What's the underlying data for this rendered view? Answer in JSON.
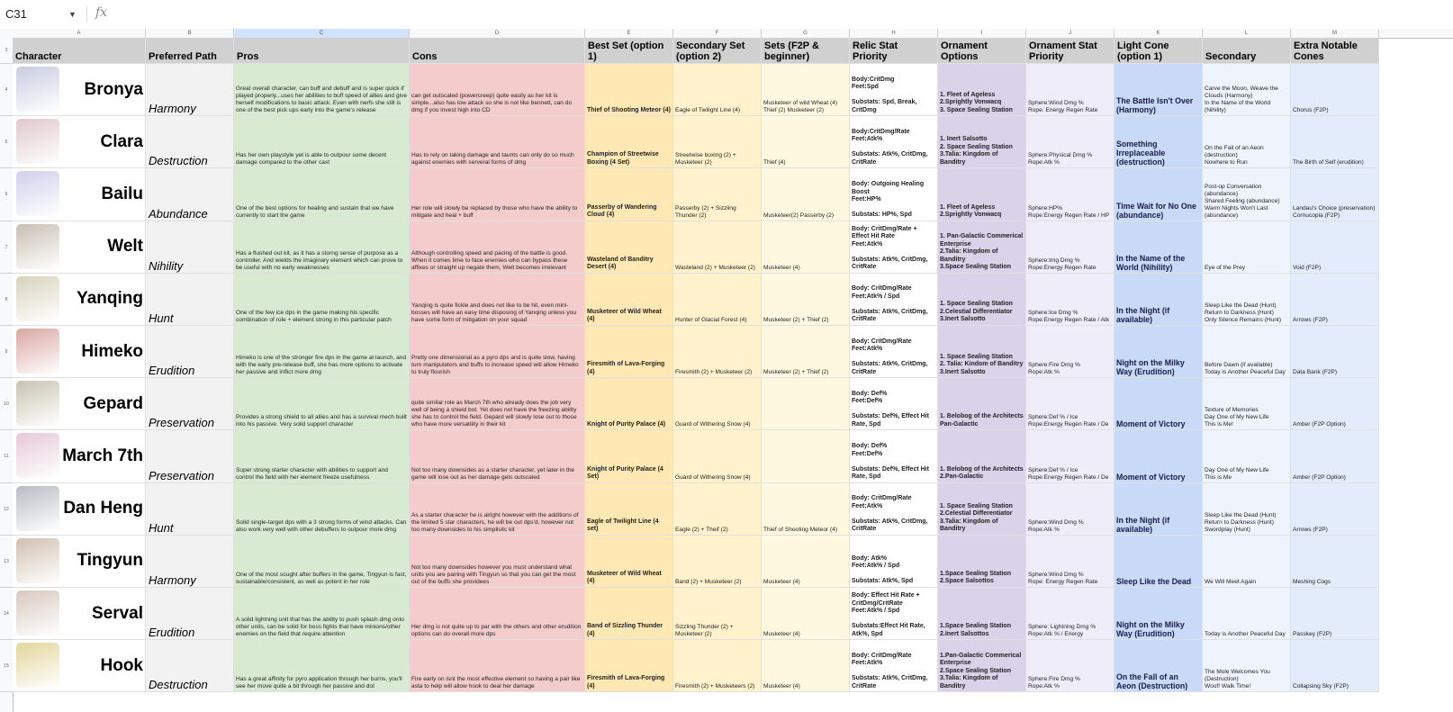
{
  "formula_bar": {
    "cell_ref": "C31",
    "fx_label": "fx",
    "formula": ""
  },
  "column_letters": [
    "A",
    "B",
    "C",
    "D",
    "E",
    "F",
    "G",
    "H",
    "I",
    "J",
    "K",
    "L",
    "M"
  ],
  "selected_column": "C",
  "row_numbers": [
    "3",
    "4",
    "5",
    "6",
    "7",
    "8",
    "9",
    "10",
    "11",
    "12",
    "13",
    "14",
    "15"
  ],
  "headers": [
    "Character",
    "Preferred Path",
    "Pros",
    "Cons",
    "Best Set (option 1)",
    "Secondary Set (option 2)",
    "Sets (F2P & beginner)",
    "Relic Stat Priority",
    "Ornament Options",
    "Ornament Stat Priority",
    "Light Cone (option 1)",
    "Secondary",
    "Extra Notable Cones"
  ],
  "characters": [
    {
      "name": "Bronya",
      "path": "Harmony",
      "portrait_color": "#c8cde0",
      "pros": "Great overall character, can buff and debuff and is super quick if played properly...uses her abilities to buff speed of allies and give herself modifications to basic attack. Even with nerfs she still is one of the best pick ups early into the game's release",
      "cons": "can get outscaled (powercreep) quite easily as her kit is simple...also has low attack so she is not like bennett, can do dmg if you invest high into CD",
      "best": "Thief of Shooting Meteor (4)",
      "secondary": "Eagle of Twilight Line (4)",
      "sets": "Musketeer of wild Wheat (4)\nThief (2) Musketeer (2)",
      "relic": "Body:CritDmg\nFeet:Spd\n\nSubstats: Spd, Break, CritDmg",
      "ornament": "1. Fleet of Ageless\n2.Sprightly Vonwacq\n3. Space Sealing Station",
      "ornament_stat": "Sphere:Wind Dmg %\nRope: Energy Regen Rate",
      "lc": "The Battle Isn't Over (Harmony)",
      "lc2": "Carve the Moon, Weave the Clouds (Harmony)\nIn the Name of the World (Nihility)",
      "extra": "Chorus (F2P)"
    },
    {
      "name": "Clara",
      "path": "Destruction",
      "portrait_color": "#e0c8cc",
      "pros": "Has her own playstyle yet is able to outpour some decent damage compared to the other cast",
      "cons": "Has to rely on taking damage and taunts can only do so much against enemies with serveral forms of dmg",
      "best": "Champion of Streetwise Boxing (4 Set)",
      "secondary": "Streetwise boxing (2) + Musketeer (2)",
      "sets": "Thief (4)",
      "relic": "Body:CritDmg/Rate\nFeet:Atk%\n\nSubstats: Atk%, CritDmg, CritRate",
      "ornament": "1. Inert Salsotto\n2. Space Sealing Station\n3.Talia: Kingdom of Banditry",
      "ornament_stat": "Sphere:Physical Dmg %\nRope:Atk %",
      "lc": "Something Irreplaceable (destruction)",
      "lc2": "On the Fall of an Aeon (destruction)\nNowhere to Run",
      "extra": "The Birth of Self (erudition)"
    },
    {
      "name": "Bailu",
      "path": "Abundance",
      "portrait_color": "#cfd0ea",
      "pros": "One of the best options for healing and sustain that we have currently to start the game",
      "cons": "Her role will slowly be replaced by those who have the ability to mitigate and heal + buff",
      "best": "Passerby of Wandering Cloud (4)",
      "secondary": "Passerby (2) + Sizzling Thunder (2)",
      "sets": "Musketeer(2) Passerby (2)",
      "relic": "Body: Outgoing Healing Boost\nFeet:HP%\n\nSubstats: HP%, Spd",
      "ornament": "1. Fleet of Ageless\n2.Sprightly Vonwacq",
      "ornament_stat": "Sphere:HP%\nRope:Energy Regen Rate / HP",
      "lc": "Time Wait for No One (abundance)",
      "lc2": "Post-op Conversation (abundance)\nShared Feeling (abundance)\nWarm Nights Won't Last (abundance)",
      "extra": "Landau's Choice (preservation)\nCornucopia (F2P)"
    },
    {
      "name": "Welt",
      "path": "Nihility",
      "portrait_color": "#c9bfb3",
      "pros": "Has a flushed out kit, as it has a storng sense of purpose as a controller. And wields the imaginary element which can prove to be useful with no early weaknesses",
      "cons": "Although controlling speed and pacing of the battle is good. When it comes time to face enemies who can bypass these affixes or straight up negate them, Welt becomes irrelevant",
      "best": "Wasteland of Banditry Desert (4)",
      "secondary": "Wasteland (2) + Musketeer (2)",
      "sets": "Musketeer (4)",
      "relic": "Body: CritDmg/Rate + Effect Hit Rate\nFeet:Atk%\n\nSubstats: Atk%, CritDmg, CritRate",
      "ornament": "1. Pan-Galactic Commerical Enterprise\n2.Talia: Kingdom of Banditry\n3.Space Sealing Station",
      "ornament_stat": "Sphere:Img Dmg %\nRope:Energy Regen Rate",
      "lc": "In the Name of the World (Nihility)",
      "lc2": "Eye of the Prey",
      "extra": "Void (F2P)"
    },
    {
      "name": "Yanqing",
      "path": "Hunt",
      "portrait_color": "#d9d2bc",
      "pros": "One of the few ice dps in the game making his specific combination of role + element strong in this particular patch",
      "cons": "Yanqing is quite fickle and does not like to be hit, even mini-bosses will have an easy time disposing of Yanqing unless you have some form of mitigation on your squad",
      "best": "Musketeer of Wild Wheat (4)",
      "secondary": "Hunter of Glacial Forest (4)",
      "sets": "Musketeer (2) + Thief (2)",
      "relic": "Body: CritDmg/Rate\nFeet:Atk% / Spd\n\nSubstats: Atk%, CritDmg, CritRate",
      "ornament": "1. Space Sealing Station\n2.Celestial Differentiator\n3.Inert Salsotto",
      "ornament_stat": "Sphere:Ice Dmg %\nRope:Energy Regen Rate / Atk",
      "lc": "In the Night (if available)",
      "lc2": "Sleep Like the Dead (Hunt)\nReturn to Darkness (Hunt)\nOnly Silence Remains (Hunt)",
      "extra": "Arrows (F2P)"
    },
    {
      "name": "Himeko",
      "path": "Erudition",
      "portrait_color": "#d9a6a2",
      "pros": "Himeko is one of the stronger fire dps in the game at launch, and with the early pre-release buff, she has more options to activate her passive and inflict more dmg",
      "cons": "Pretty one dimensional as a pyro dps and is quite slow, having turn manipulators and buffs to increase speed will allow Himeko to truly flourish",
      "best": "Firesmith of Lava-Forging (4)",
      "secondary": "Firesmith (2) + Musketeer (2)",
      "sets": "Musketeer (2) + Thief (2)",
      "relic": "Body: CritDmg/Rate\nFeet:Atk%\n\nSubstats: Atk%, CritDmg, CritRate",
      "ornament": "1. Space Sealing Station\n2. Talia: Kindom of Banditry\n3.Inert Salsotto",
      "ornament_stat": "Sphere:Fire Dmg %\nRope:Atk %",
      "lc": "Night on the Milky Way (Erudition)",
      "lc2": "Before Dawn (if available)\nToday is Another Peaceful Day",
      "extra": "Data Bank (F2P)"
    },
    {
      "name": "Gepard",
      "path": "Preservation",
      "portrait_color": "#c9c3b0",
      "pros": "Provides a strong shield to all allies and has a survival mech built into his passive. Very solid support character",
      "cons": "quite similar role as March 7th who already does the job very well of being a shield bot. Yet does not have the freezing ability she has to control the field. Gepard will slowly lose out to those who have more versatility in their kit",
      "best": "Knight of Purity Palace (4)",
      "secondary": "Guard of Withering Snow (4)",
      "sets": "",
      "relic": "Body: Def%\nFeet:Def%\n\nSubstats: Def%, Effect Hit Rate, Spd",
      "ornament": "1. Belobog of the Architects\nPan-Galactic",
      "ornament_stat": "Sphere:Def % / Ice\nRope:Energy Regen Rate / De",
      "lc": "Moment of Victory",
      "lc2": "Texture of Memories\nDay One of My New Life\nThis is Me!",
      "extra": "Amber (F2P Option)"
    },
    {
      "name": "March 7th",
      "path": "Preservation",
      "portrait_color": "#e6c9d5",
      "pros": "Super strong starter character with abilities to support and control the field with her element freeze usefulness",
      "cons": "Not too many downsides as a starter character, yet later in the game will lose out as her damage gets outscaled",
      "best": "Knight of Purity Palace (4 Set)",
      "secondary": "Guard of Withering Snow (4)",
      "sets": "",
      "relic": "Body: Def%\nFeet:Def%\n\nSubstats: Def%, Effect Hit Rate, Spd",
      "ornament": "1. Belobog of the Architects 2.Pan-Galactic",
      "ornament_stat": "Sphere:Def % / Ice\nRope:Energy Regen Rate / De",
      "lc": "Moment of Victory",
      "lc2": "Day One of My New Life\nThis is Me",
      "extra": "Amber (F2P Option)"
    },
    {
      "name": "Dan Heng",
      "path": "Hunt",
      "portrait_color": "#b9bcc4",
      "pros": "Solid single-target dps with a 3 strong forms of wind attacks. Can also work very well with other debuffers to outpour more dmg",
      "cons": "As a starter character he is alright however with the additions of the limited 5 star characters, he will be out dps'd, however not too many downsides to his simplisitc kit",
      "best": "Eagle of Twilight Line (4 set)",
      "secondary": "Eagle (2) + Theif (2)",
      "sets": "Thief of Shooting Meteor (4)",
      "relic": "Body: CritDmg/Rate\nFeet:Atk%\n\nSubstats: Atk%, CritDmg, CritRate",
      "ornament": "1. Space Sealing Station\n2.Celestial Differentiator\n3.Talia: Kingdom of Banditry",
      "ornament_stat": "Sphere:Wind Dmg %\nRope:Atk %",
      "lc": "In the Night (if available)",
      "lc2": "Sleep Like the Dead (Hunt)\nReturn to Darkness (Hunt)\nSwordplay (Hunt)",
      "extra": "Arrows (F2P)"
    },
    {
      "name": "Tingyun",
      "path": "Harmony",
      "portrait_color": "#d2bfb0",
      "pros": "One of the most sought after buffers in the game, Tingyun is fast, sustainable/consistent, as well as potent in her role",
      "cons": "Not too many downsides however you must understand what units you are pairing with Tingyun so that you can get the most out of the buffs she providees",
      "best": "Musketeer of Wild Wheat (4)",
      "secondary": "Band (2) + Musketeer (2)",
      "sets": "Musketeer (4)",
      "relic": "Body: Atk%\nFeet:Atk% / Spd\n\nSubstats: Atk%, Spd",
      "ornament": "1.Space Sealing Station\n2.Space Salsottos",
      "ornament_stat": "Sphere:Wind Dmg %\nRope: Energy Regen Rate",
      "lc": "Sleep Like the Dead",
      "lc2": "We Will Meet Again",
      "extra": "Meshing Cogs"
    },
    {
      "name": "Serval",
      "path": "Erudition",
      "portrait_color": "#d8c9bf",
      "pros": "A solid lightning unit that has the ability to push splash dmg onto other units, can be solid for boss fights that have minions/other enemies on the field that require attention",
      "cons": "Her dmg is not quite up to par with the others and other erudition options can do overall more dps",
      "best": "Band of Sizzling Thunder (4)",
      "secondary": "Sizzling Thunder (2) + Musketeer (2)",
      "sets": "Musketeer (4)",
      "relic": "Body: Effect Hit Rate + CritDmg/CritRate\nFeet:Atk% / Spd\n\nSubstats:Effect Hit Rate, Atk%, Spd",
      "ornament": "1.Space Sealing Station\n2.Inert Salsottos",
      "ornament_stat": "Sphere: Lightning Dmg %\nRope:Atk % / Energy",
      "lc": "Night on the Milky Way (Erudition)",
      "lc2": "Today is Another Peaceful Day",
      "extra": "Passkey (F2P)"
    },
    {
      "name": "Hook",
      "path": "Destruction",
      "portrait_color": "#e3d59a",
      "pros": "Has a great affinity for pyro application through her burns, you'll see her move quite a bit through her passive and dot",
      "cons": "Fire early on isnt the most effective element so having a pair like asta to help will allow hook to deal her damage",
      "best": "Firesmith of Lava-Forging (4)",
      "secondary": "Firesmith (2) + Musketeers (2)",
      "sets": "Musketeer (4)",
      "relic": "Body: CritDmg/Rate\nFeet:Atk%\n\nSubstats: Atk%, CritDmg, CritRate",
      "ornament": "1.Pan-Galactic Commerical Enterprise\n2.Space Sealing Station\n3.Talia: Kingdom of Banditry",
      "ornament_stat": "Sphere:Fire Dmg %\nRope:Atk %",
      "lc": "On the Fall of an Aeon (Destruction)",
      "lc2": "The Mole Welcomes You (Destruction)\nWoof! Walk Time!",
      "extra": "Collapsing Sky (F2P)"
    }
  ]
}
